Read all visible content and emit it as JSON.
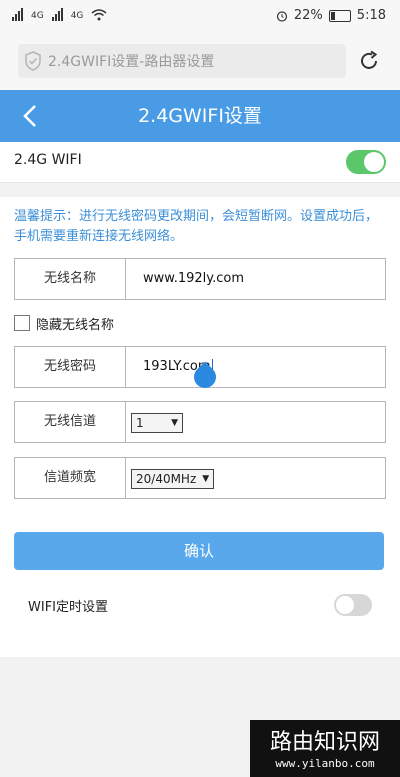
{
  "status": {
    "signal1": "4G",
    "signal2": "4G",
    "battery": "22%",
    "time": "5:18"
  },
  "browser": {
    "url_title": "2.4GWIFI设置-路由器设置"
  },
  "header": {
    "title": "2.4GWIFI设置"
  },
  "wifi": {
    "label": "2.4G WIFI",
    "enabled": true
  },
  "tip": "温馨提示：进行无线密码更改期间，会短暂断网。设置成功后，手机需要重新连接无线网络。",
  "form": {
    "ssid_label": "无线名称",
    "ssid_value": "www.192ly.com",
    "hide_label": "隐藏无线名称",
    "password_label": "无线密码",
    "password_value": "193LY.com",
    "channel_label": "无线信道",
    "channel_value": "1",
    "bandwidth_label": "信道频宽",
    "bandwidth_value": "20/40MHz",
    "confirm_label": "确认"
  },
  "timer": {
    "label": "WIFI定时设置",
    "enabled": false
  },
  "watermark": {
    "title": "路由知识网",
    "url": "www.yilanbo.com"
  }
}
